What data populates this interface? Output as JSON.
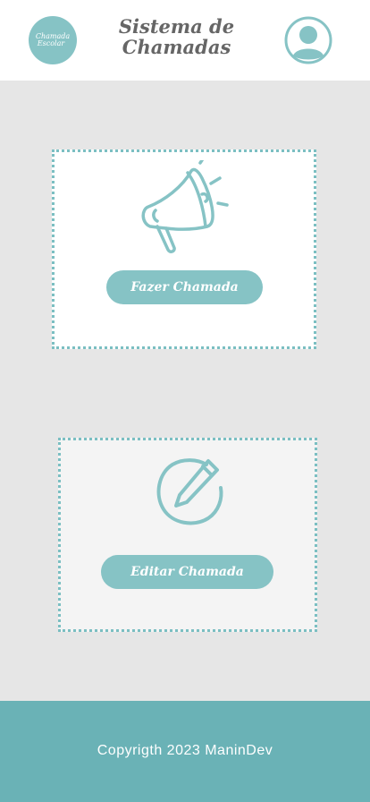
{
  "header": {
    "logo_line1": "Chamada",
    "logo_line2": "Escolar",
    "title": "Sistema de Chamadas"
  },
  "cards": {
    "call": {
      "icon": "megaphone-icon",
      "button_label": "Fazer Chamada"
    },
    "edit": {
      "icon": "pencil-circle-icon",
      "button_label": "Editar Chamada"
    }
  },
  "footer": {
    "copyright": "Copyrigth 2023 ManinDev"
  },
  "colors": {
    "accent": "#86c3c5",
    "footer": "#6ab2b6",
    "background": "#e6e6e6"
  }
}
